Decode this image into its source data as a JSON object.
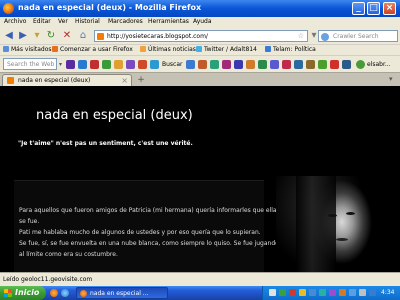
{
  "window": {
    "title": "nada en especial (deux) - Mozilla Firefox"
  },
  "menu": [
    "Archivo",
    "Editar",
    "Ver",
    "Historial",
    "Marcadores",
    "Herramientas",
    "Ayuda"
  ],
  "nav": {
    "url": "http://yosietecaras.blogspot.com/",
    "search_placeholder": "Crawler Search"
  },
  "bookmarks": [
    {
      "label": "Más visitados",
      "color": "#5a8fd8"
    },
    {
      "label": "Comenzar a usar Firefox",
      "color": "#e8701a"
    },
    {
      "label": "Últimas noticias",
      "color": "#f2a23a"
    },
    {
      "label": "Twitter / Adalt814",
      "color": "#43b1e3"
    },
    {
      "label": "Telam: Política",
      "color": "#3a7bd5"
    }
  ],
  "yahoo": {
    "search_placeholder": "Search the Web",
    "search_button": "Buscar",
    "user_label": "elsabr..."
  },
  "tab": {
    "label": "nada en especial (deux)"
  },
  "page": {
    "title": "nada en especial (deux)",
    "tagline": "\"Je t'aime\" n'est pas un sentiment, c'est une vérité.",
    "post_lines": [
      "Para aquellos que fueron amigos de Patricia (mi hermana) quería informarles que ella",
      "se fue.",
      "Pati me hablaba mucho de algunos de ustedes y por eso quería que lo supieran.",
      "Se fue, sí, se fue envuelta en una nube blanca, como siempre lo quiso. Se fue jugando",
      "al límite como era su costumbre."
    ]
  },
  "status": {
    "text": "Leído geoloc11.geovisite.com"
  },
  "taskbar": {
    "start_label": "Inicio",
    "task_label": "nada en especial ...",
    "clock": "4:34"
  }
}
